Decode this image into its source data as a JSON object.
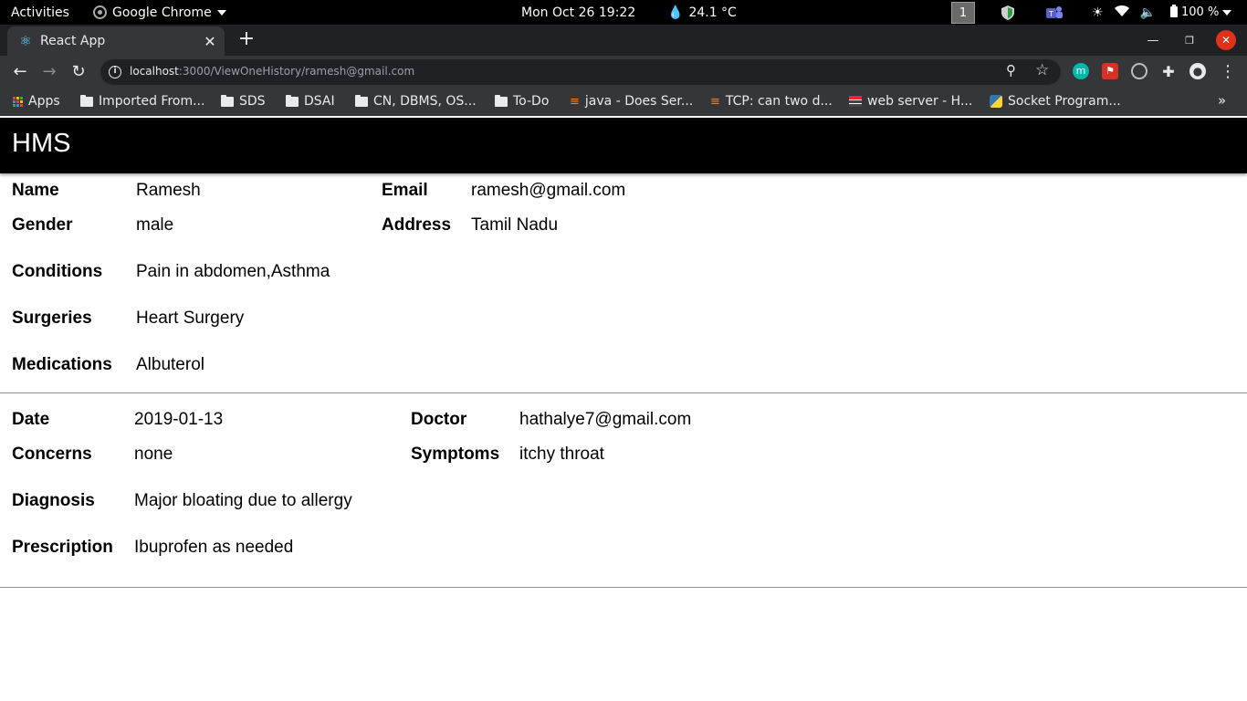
{
  "system_bar": {
    "activities": "Activities",
    "app_name": "Google Chrome",
    "clock": "Mon Oct 26  19:22",
    "weather": "24.1 °C",
    "workspace": "1",
    "battery": "100 %"
  },
  "browser": {
    "tab_title": "React App",
    "url_host": "localhost",
    "url_rest": ":3000/ViewOneHistory/ramesh@gmail.com",
    "bookmarks": [
      {
        "label": "Apps",
        "icon": "apps-grid-icon"
      },
      {
        "label": "Imported From...",
        "icon": "folder-icon"
      },
      {
        "label": "SDS",
        "icon": "folder-icon"
      },
      {
        "label": "DSAI",
        "icon": "folder-icon"
      },
      {
        "label": "CN, DBMS, OS...",
        "icon": "folder-icon"
      },
      {
        "label": "To-Do",
        "icon": "folder-icon"
      },
      {
        "label": "java - Does Ser...",
        "icon": "stackoverflow-icon"
      },
      {
        "label": "TCP: can two d...",
        "icon": "stackoverflow-icon"
      },
      {
        "label": "web server - H...",
        "icon": "serverfault-icon"
      },
      {
        "label": "Socket Program...",
        "icon": "python-icon"
      }
    ],
    "extension_m_label": "m"
  },
  "app": {
    "title": "HMS"
  },
  "patient": {
    "name_label": "Name",
    "name": "Ramesh",
    "email_label": "Email",
    "email": "ramesh@gmail.com",
    "gender_label": "Gender",
    "gender": "male",
    "address_label": "Address",
    "address": "Tamil Nadu",
    "conditions_label": "Conditions",
    "conditions": "Pain in abdomen,Asthma",
    "surgeries_label": "Surgeries",
    "surgeries": "Heart Surgery",
    "medications_label": "Medications",
    "medications": "Albuterol"
  },
  "visit": {
    "date_label": "Date",
    "date": "2019-01-13",
    "doctor_label": "Doctor",
    "doctor": "hathalye7@gmail.com",
    "concerns_label": "Concerns",
    "concerns": "none",
    "symptoms_label": "Symptoms",
    "symptoms": "itchy throat",
    "diagnosis_label": "Diagnosis",
    "diagnosis": "Major bloating due to allergy",
    "prescription_label": "Prescription",
    "prescription": "Ibuprofen as needed"
  },
  "colors": {
    "header_bg": "#000000",
    "chrome_dark": "#35363a",
    "divider": "#8c8c8c"
  }
}
